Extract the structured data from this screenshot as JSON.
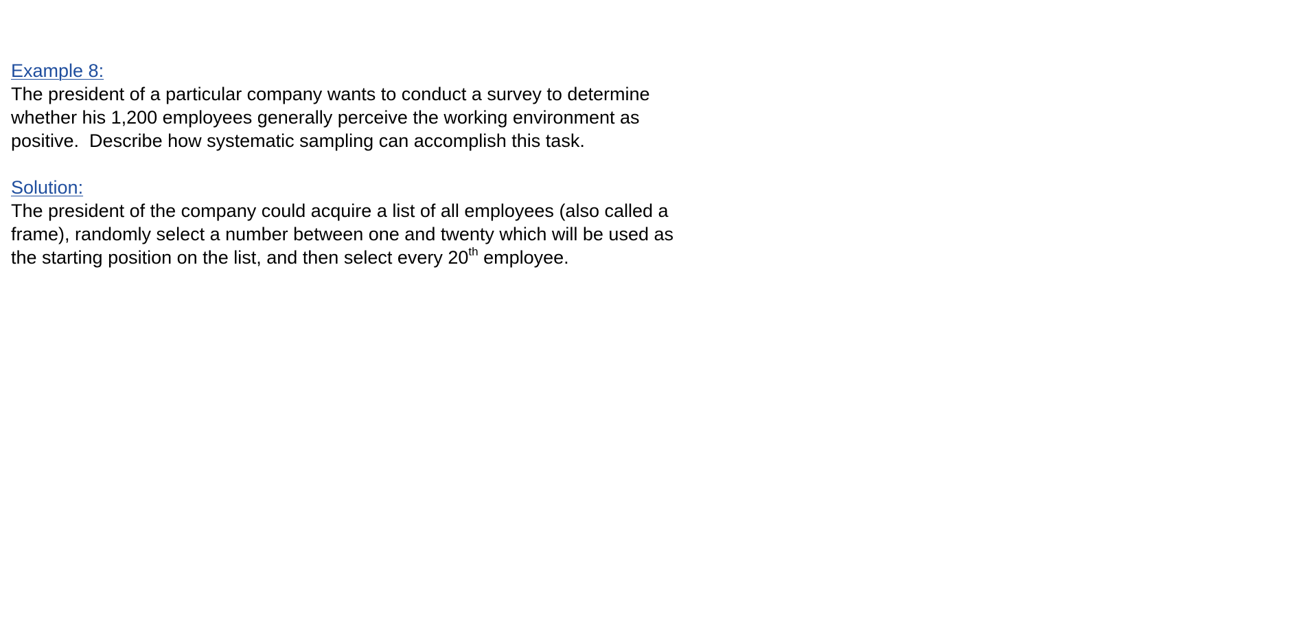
{
  "example": {
    "heading": "Example 8:",
    "lines": [
      "The president of a particular company wants to conduct a survey to determine",
      "whether his 1,200 employees generally perceive the working environment as",
      "positive.  Describe how systematic sampling can accomplish this task."
    ]
  },
  "solution": {
    "heading": "Solution:",
    "lines": [
      "The president of the company could acquire a list of all employees (also called a",
      "frame), randomly select a number between one and twenty which will be used as"
    ],
    "last_line_prefix": "the starting position on the list, and then select every 20",
    "last_line_superscript": "th",
    "last_line_suffix": " employee."
  },
  "colors": {
    "heading": "#1f4e9e",
    "body_text": "#000000",
    "background": "#ffffff"
  }
}
